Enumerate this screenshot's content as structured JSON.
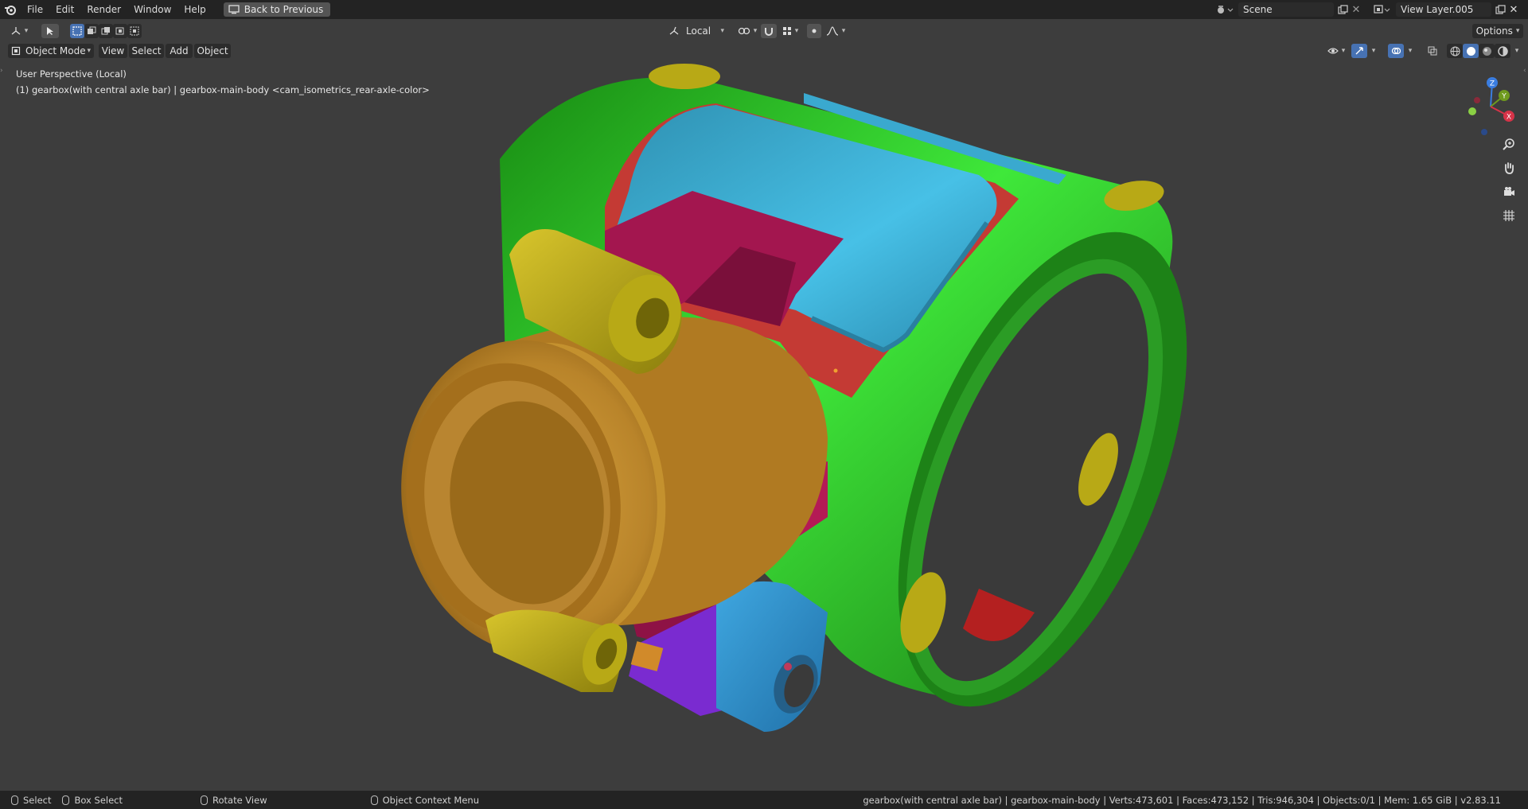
{
  "menu": {
    "file": "File",
    "edit": "Edit",
    "render": "Render",
    "window": "Window",
    "help": "Help",
    "back": "Back to Previous"
  },
  "scene": {
    "name": "Scene",
    "view_layer": "View Layer.005"
  },
  "toolbar": {
    "mode": "Object Mode",
    "view": "View",
    "select": "Select",
    "add": "Add",
    "object": "Object",
    "transform_orientation": "Local",
    "options": "Options"
  },
  "viewport": {
    "perspective_label": "User Perspective (Local)",
    "object_info": "(1) gearbox(with central axle bar) | gearbox-main-body <cam_isometrics_rear-axle-color>",
    "colors": {
      "green": "#2fc92a",
      "cyan": "#3aa9cf",
      "magenta": "#a3164f",
      "gold": "#c08d2a",
      "yellow": "#b8a916",
      "red": "#c03030",
      "purple": "#7a2bd0"
    }
  },
  "gizmo": {
    "x": "X",
    "y": "Y",
    "z": "Z"
  },
  "nav_icons": [
    "zoom-icon",
    "pan-hand-icon",
    "camera-icon",
    "grid-icon"
  ],
  "statusbar": {
    "select": "Select",
    "box_select": "Box Select",
    "rotate_view": "Rotate View",
    "context_menu": "Object Context Menu",
    "stats": "gearbox(with central axle bar) | gearbox-main-body | Verts:473,601 | Faces:473,152 | Tris:946,304 | Objects:0/1 | Mem: 1.65 GiB | v2.83.11"
  }
}
